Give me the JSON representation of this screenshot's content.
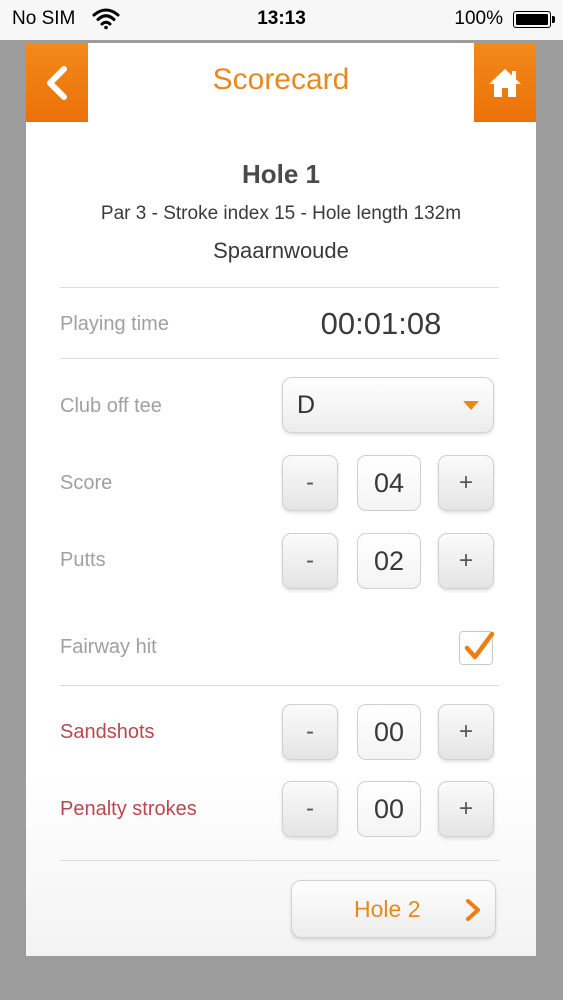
{
  "status_bar": {
    "carrier": "No SIM",
    "time": "13:13",
    "battery": "100%"
  },
  "header": {
    "title": "Scorecard",
    "back_icon": "chevron-left-icon",
    "home_icon": "home-icon",
    "accent_color": "#EE7D14"
  },
  "hole": {
    "title": "Hole 1",
    "info": "Par 3 - Stroke index 15 - Hole length 132m",
    "course": "Spaarnwoude"
  },
  "playing_time": {
    "label": "Playing time",
    "value": "00:01:08"
  },
  "club_off_tee": {
    "label": "Club off tee",
    "selected": "D"
  },
  "score": {
    "label": "Score",
    "value": "04",
    "minus": "-",
    "plus": "+"
  },
  "putts": {
    "label": "Putts",
    "value": "02",
    "minus": "-",
    "plus": "+"
  },
  "fairway_hit": {
    "label": "Fairway hit",
    "checked": true
  },
  "sandshots": {
    "label": "Sandshots",
    "value": "00",
    "minus": "-",
    "plus": "+"
  },
  "penalty_strokes": {
    "label": "Penalty strokes",
    "value": "00",
    "minus": "-",
    "plus": "+"
  },
  "next": {
    "label": "Hole 2"
  }
}
